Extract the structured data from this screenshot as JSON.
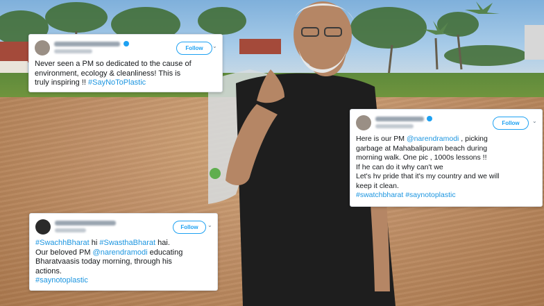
{
  "tweet1": {
    "follow_label": "Follow",
    "text_a": "Never seen a PM so dedicated to the cause of",
    "text_b": "environment, ecology & cleanliness! This is",
    "text_c": "truly inspiring !! ",
    "hashtag": "#SayNoToPlastic"
  },
  "tweet2": {
    "follow_label": "Follow",
    "line1_pre": "Here is our  PM ",
    "mention": "@narendramodi",
    "line1_post": " , picking",
    "line2": "garbage at Mahabalipuram beach during",
    "line3": "morning walk. One pic , 1000s lessons !!",
    "line4": "If he can do it why can't we",
    "line5": "Let's hv pride that it's my country and we will",
    "line6": "keep it clean.",
    "hashtag1": "#swatchbharat",
    "hashtag2": "#saynotoplastic"
  },
  "tweet3": {
    "follow_label": "Follow",
    "hashtag1": "#SwachhBharat",
    "mid": " hi ",
    "hashtag2": "#SwasthaBharat",
    "end": " hai.",
    "line2_pre": "Our beloved PM ",
    "mention": "@narendramodi",
    "line2_post": " educating",
    "line3": "Bharatvaasis today morning, through his",
    "line4": "actions.",
    "hashtag3": "#saynotoplastic"
  },
  "colors": {
    "link": "#1b95e0",
    "follow": "#1da1f2",
    "text": "#14171a"
  },
  "icons": [
    "avatar",
    "verified-badge-icon",
    "chevron-down-icon"
  ]
}
